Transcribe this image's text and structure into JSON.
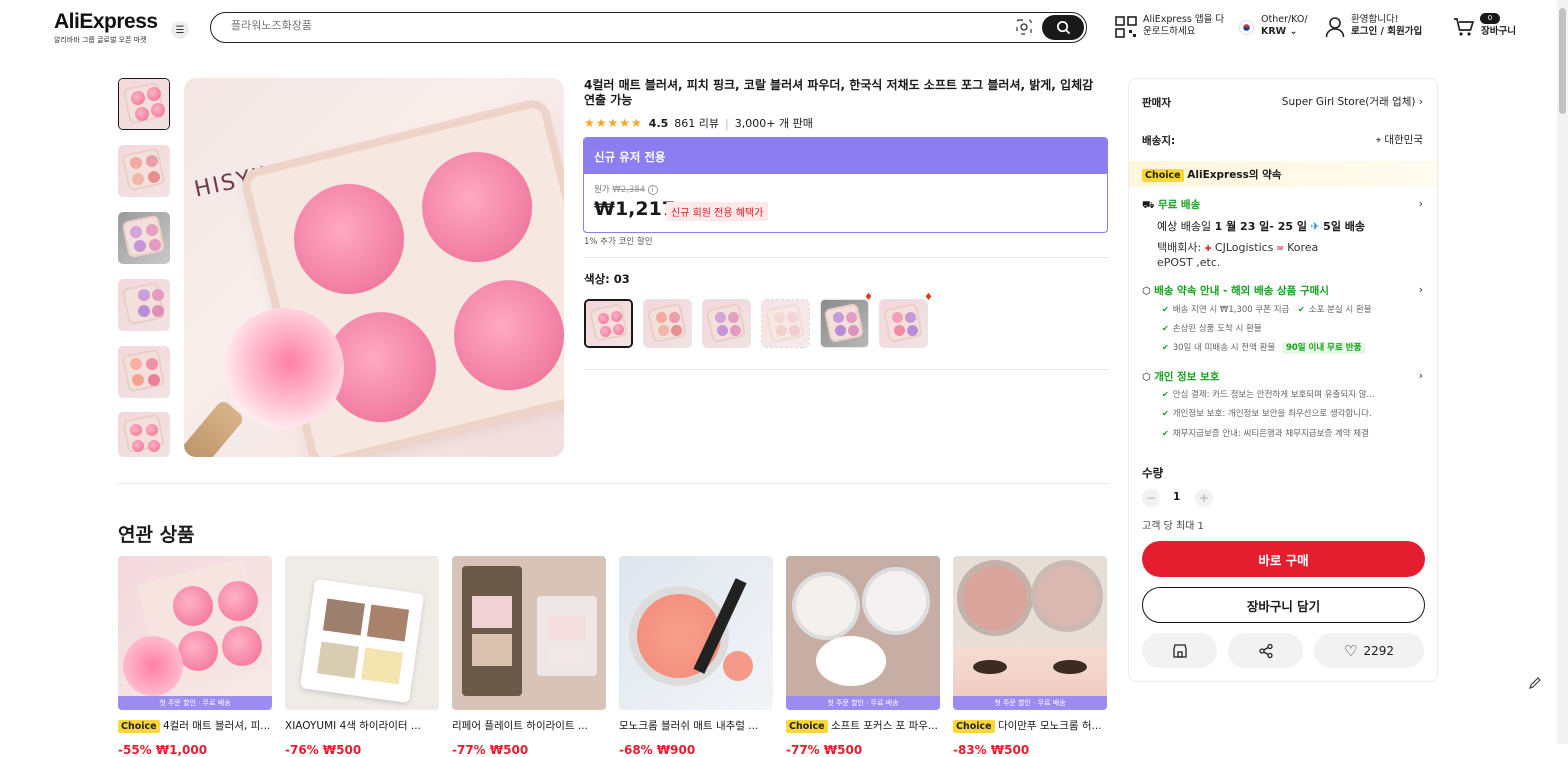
{
  "header": {
    "logo": "AliExpress",
    "logo_sub": "알리바바 그룹 글로벌 오픈 마켓",
    "search_placeholder": "플라워노즈화장품",
    "app_line1": "AliExpress 앱을 다",
    "app_line2": "운로드하세요",
    "region_line1": "Other/KO/",
    "region_line2": "KRW",
    "account_line1": "환영합니다!",
    "account_line2": "로그인 / 회원가입",
    "cart_count": "0",
    "cart_label": "장바구니"
  },
  "product": {
    "title": "4컬러 매트 블러셔, 피치 핑크, 코랄 블러셔 파우더, 한국식 저채도 소프트 포그 블러셔, 밝게, 입체감 연출 가능",
    "rating": "4.5",
    "reviews": "861 리뷰",
    "sold": "3,000+ 개 판매",
    "promo_header": "신규 유저 전용",
    "orig_label": "원가",
    "orig_price": "₩2,384",
    "price": "₩1,217",
    "new_user_badge": "신규 회원 전용 혜택가",
    "coin_note": "1% 추가 코인 할인",
    "color_label": "색상: 03",
    "brand_on_image": "HISYII"
  },
  "seller_panel": {
    "seller_label": "판매자",
    "seller_name": "Super Girl Store(거래 업체)",
    "ship_to_label": "배송지:",
    "ship_to": "대한민국",
    "choice_tag": "Choice",
    "choice_promise": "AliExpress의 약속",
    "free_shipping": "무료 배송",
    "delivery_prefix": "예상 배송일",
    "delivery_dates": "1 월 23 일- 25 일",
    "delivery_suffix": "5일 배송",
    "carrier_label": "택배회사:",
    "carrier1": "CJLogistics",
    "carrier2": "Korea",
    "carrier3": "ePOST ,etc.",
    "guarantee_title": "배송 약속 안내 - 해외 배송 상품 구매시",
    "guarantee_1": "배송 지연 시 ₩1,300 쿠폰 지급",
    "guarantee_2": "소포 분실 시 환불",
    "guarantee_3": "손상된 상품 도착 시 환불",
    "guarantee_4": "30일 내 미배송 시 전액 환불",
    "guarantee_4_badge": "90일 이내 무료 반품",
    "privacy_title": "개인 정보 보호",
    "privacy_1": "안심 결제: 카드 정보는 안전하게 보호되며 유출되지 않...",
    "privacy_2": "개인정보 보호: 개인정보 보안을 최우선으로 생각합니다.",
    "privacy_3": "채무지급보증 안내: 씨티은행과 채무지급보증 계약 체결",
    "qty_label": "수량",
    "qty_value": "1",
    "limit": "고객 당 최대 1",
    "buy_now": "바로 구매",
    "add_to_cart": "장바구니 담기",
    "wishlist_count": "2292"
  },
  "related": {
    "title": "연관 상품",
    "band_text": "첫 주문 할인 · 무료 배송",
    "items": [
      {
        "title": "4컬러 매트 블러셔, 피...",
        "choice": true,
        "price": "-55% ₩1,000"
      },
      {
        "title": "XIAOYUMI 4색 하이라이터 ...",
        "choice": false,
        "price": "-76% ₩500"
      },
      {
        "title": "리페어 플레이트 하이라이트 ...",
        "choice": false,
        "price": "-77% ₩500"
      },
      {
        "title": "모노크롬 블러쉬 매트 내추럴 ...",
        "choice": false,
        "price": "-68% ₩900"
      },
      {
        "title": "소프트 포커스 포 파우...",
        "choice": true,
        "price": "-77% ₩500"
      },
      {
        "title": "다이만푸 모노크롬 허...",
        "choice": true,
        "price": "-83% ₩500"
      }
    ]
  },
  "colors": {
    "accent_red": "#e51e2f",
    "promo_purple": "#8c7ef0",
    "green": "#12a11a",
    "choice_yellow": "#fdd835"
  }
}
